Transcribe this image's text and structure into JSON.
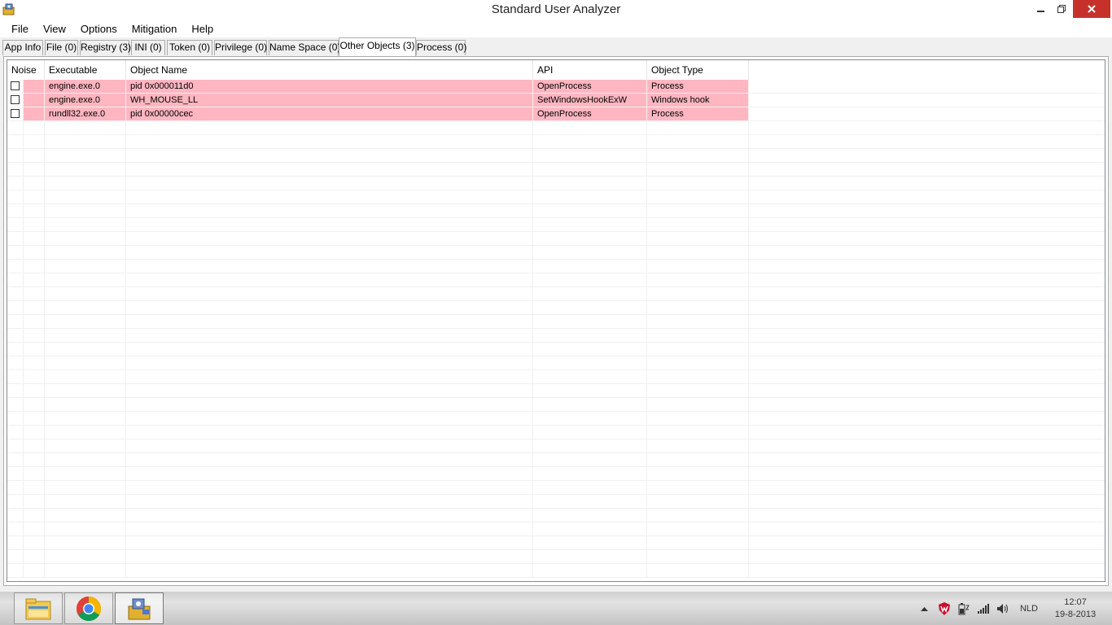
{
  "window": {
    "title": "Standard User Analyzer"
  },
  "menu": [
    "File",
    "View",
    "Options",
    "Mitigation",
    "Help"
  ],
  "tabs": [
    {
      "label": "App Info",
      "active": false
    },
    {
      "label": "File (0)",
      "active": false
    },
    {
      "label": "Registry (3)",
      "active": false
    },
    {
      "label": "INI (0)",
      "active": false
    },
    {
      "label": "Token (0)",
      "active": false
    },
    {
      "label": "Privilege (0)",
      "active": false
    },
    {
      "label": "Name Space (0)",
      "active": false
    },
    {
      "label": "Other Objects (3)",
      "active": true
    },
    {
      "label": "Process (0)",
      "active": false
    }
  ],
  "table": {
    "columns": [
      "Noise",
      "Executable",
      "Object Name",
      "API",
      "Object Type"
    ],
    "rows": [
      {
        "noise": false,
        "executable": "engine.exe.0",
        "object_name": "pid 0x000011d0",
        "api": "OpenProcess",
        "object_type": "Process"
      },
      {
        "noise": false,
        "executable": "engine.exe.0",
        "object_name": "WH_MOUSE_LL",
        "api": "SetWindowsHookExW",
        "object_type": "Windows hook"
      },
      {
        "noise": false,
        "executable": "rundll32.exe.0",
        "object_name": "pid 0x00000cec",
        "api": "OpenProcess",
        "object_type": "Process"
      }
    ],
    "highlight_color": "#ffb6c1"
  },
  "taskbar": {
    "apps": [
      {
        "icon": "file-explorer-icon",
        "active": false
      },
      {
        "icon": "chrome-icon",
        "active": false
      },
      {
        "icon": "standard-user-analyzer-icon",
        "active": true
      }
    ],
    "tray": {
      "language": "NLD",
      "time": "12:07",
      "date": "19-8-2013"
    }
  }
}
